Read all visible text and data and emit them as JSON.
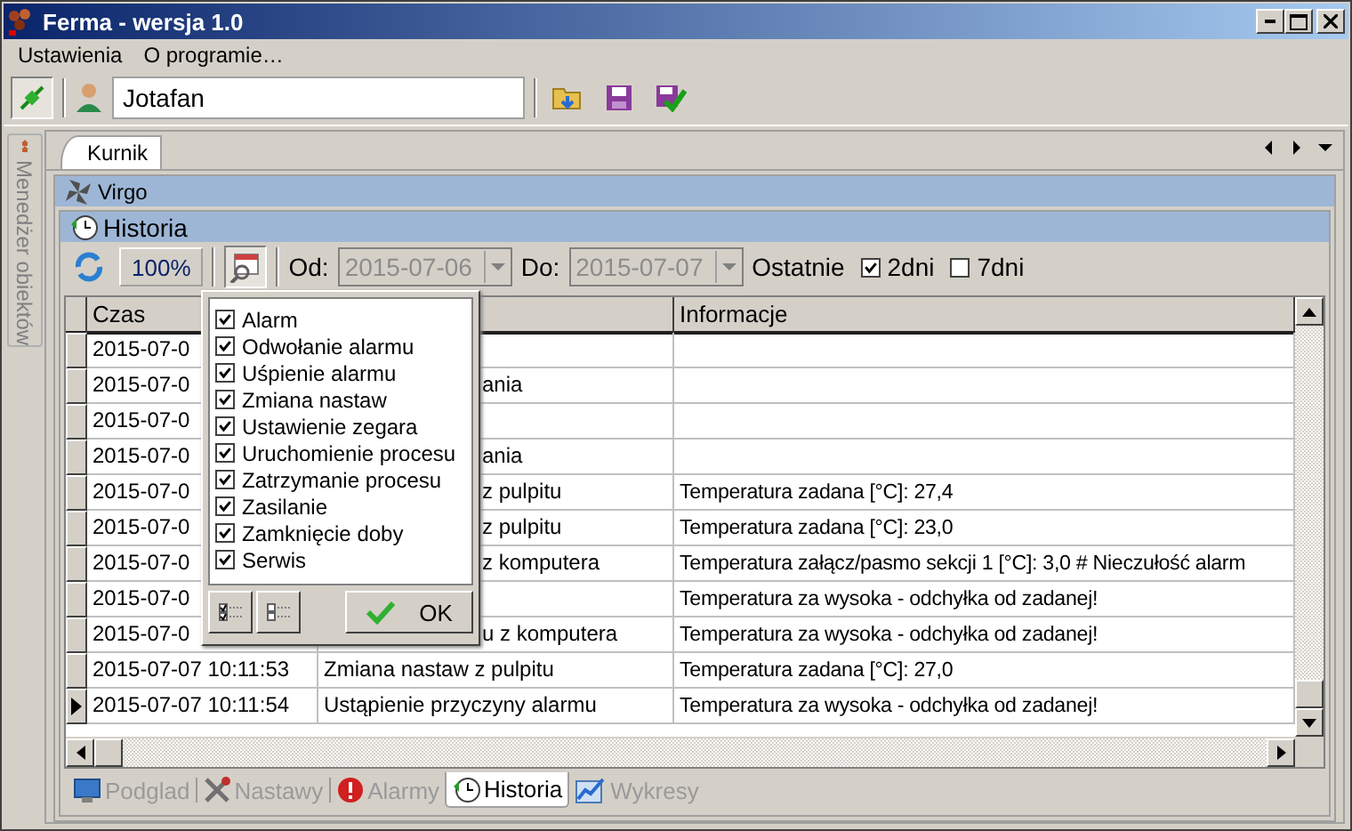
{
  "window": {
    "title": "Ferma - wersja 1.0"
  },
  "menu": [
    {
      "label": "Ustawienia"
    },
    {
      "label": "O programie…"
    }
  ],
  "toolbar": {
    "connect_pressed": true,
    "user": "Jotafan"
  },
  "side_tab": {
    "label": "Menedżer obiektów"
  },
  "tabs": [
    {
      "label": "Kurnik",
      "selected": true
    }
  ],
  "panel": {
    "title": "Virgo"
  },
  "section": {
    "title": "Historia"
  },
  "filter": {
    "zoom": "100%",
    "filter_pressed": true,
    "from_label": "Od:",
    "from": "2015-07-06",
    "to_label": "Do:",
    "to": "2015-07-07",
    "dates_disabled": true,
    "recent_label": "Ostatnie",
    "recent": [
      {
        "label": "2dni",
        "checked": true
      },
      {
        "label": "7dni",
        "checked": false
      }
    ]
  },
  "table": {
    "columns": {
      "time": "Czas",
      "info": "Informacje"
    },
    "rows": [
      {
        "time": "2015-07-0",
        "kind": "partly_hidden",
        "info": "",
        "selected": false
      },
      {
        "time": "2015-07-0",
        "event": "ania",
        "kind": "partly_hidden",
        "info": "",
        "selected": false
      },
      {
        "time": "2015-07-0",
        "kind": "partly_hidden",
        "info": "",
        "selected": false
      },
      {
        "time": "2015-07-0",
        "event": "ania",
        "kind": "partly_hidden",
        "info": "",
        "selected": false
      },
      {
        "time": "2015-07-0",
        "event": "z pulpitu",
        "kind": "partly_hidden",
        "info": "Temperatura zadana [°C]: 27,4",
        "selected": false
      },
      {
        "time": "2015-07-0",
        "event": "z pulpitu",
        "kind": "partly_hidden",
        "info": "Temperatura zadana [°C]: 23,0",
        "selected": false
      },
      {
        "time": "2015-07-0",
        "event": "z komputera",
        "kind": "partly_hidden",
        "info": "Temperatura załącz/pasmo sekcji 1 [°C]: 3,0 # Nieczułość alarm",
        "selected": false
      },
      {
        "time": "2015-07-0",
        "kind": "partly_hidden",
        "info": "Temperatura za wysoka - odchyłka od zadanej!",
        "selected": false
      },
      {
        "time": "2015-07-0",
        "event": "u z komputera",
        "kind": "partly_hidden",
        "info": "Temperatura za wysoka - odchyłka od zadanej!",
        "selected": false
      },
      {
        "time": "2015-07-07 10:11:53",
        "event": "Zmiana nastaw z pulpitu",
        "kind": "full",
        "info": "Temperatura zadana [°C]: 27,0",
        "selected": false
      },
      {
        "time": "2015-07-07 10:11:54",
        "event": "Ustąpienie przyczyny alarmu",
        "kind": "full",
        "info": "Temperatura za wysoka - odchyłka od zadanej!",
        "selected": true
      }
    ]
  },
  "popup": {
    "items": [
      {
        "label": "Alarm",
        "checked": true
      },
      {
        "label": "Odwołanie alarmu",
        "checked": true
      },
      {
        "label": "Uśpienie alarmu",
        "checked": true
      },
      {
        "label": "Zmiana nastaw",
        "checked": true
      },
      {
        "label": "Ustawienie zegara",
        "checked": true
      },
      {
        "label": "Uruchomienie procesu",
        "checked": true
      },
      {
        "label": "Zatrzymanie procesu",
        "checked": true
      },
      {
        "label": "Zasilanie",
        "checked": true
      },
      {
        "label": "Zamknięcie doby",
        "checked": true
      },
      {
        "label": "Serwis",
        "checked": true
      }
    ],
    "ok": "OK"
  },
  "bottom_tabs": [
    {
      "label": "Podglad",
      "kind": "monitor",
      "selected": false
    },
    {
      "label": "Nastawy",
      "kind": "tools",
      "selected": false
    },
    {
      "label": "Alarmy",
      "kind": "alarm",
      "selected": false
    },
    {
      "label": "Historia",
      "kind": "clock",
      "selected": true
    },
    {
      "label": "Wykresy",
      "kind": "chart",
      "selected": false
    }
  ]
}
